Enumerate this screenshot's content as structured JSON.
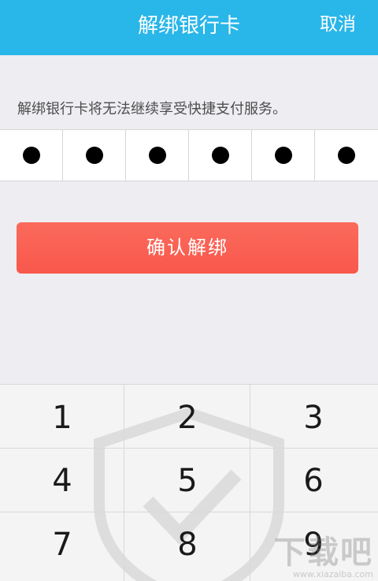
{
  "header": {
    "title": "解绑银行卡",
    "cancel_label": "取消"
  },
  "notice": "解绑银行卡将无法继续享受快捷支付服务。",
  "pin": {
    "length": 6,
    "filled": 6
  },
  "confirm_label": "确认解绑",
  "keypad": {
    "keys": [
      "1",
      "2",
      "3",
      "4",
      "5",
      "6",
      "7",
      "8",
      "9"
    ]
  },
  "watermark": {
    "logo": "下载吧",
    "url": "www.xiazaiba.com"
  },
  "colors": {
    "header_bg": "#29b6e8",
    "confirm_bg": "#f8584b",
    "page_bg": "#eeedf2"
  }
}
